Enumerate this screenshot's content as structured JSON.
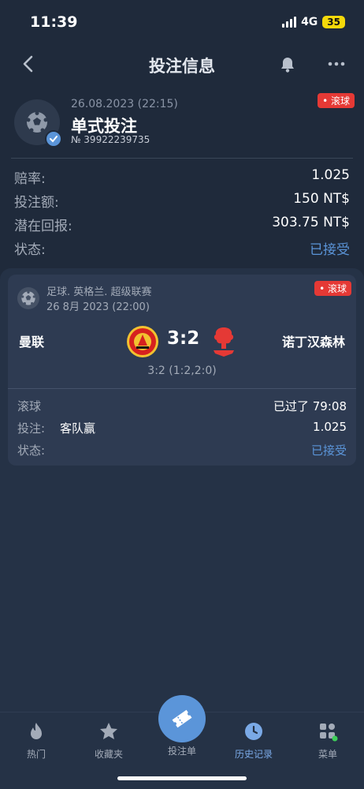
{
  "status_bar": {
    "time": "11:39",
    "network": "4G",
    "battery": "35"
  },
  "header": {
    "title": "投注信息",
    "icons": [
      "chevron-left-icon",
      "bell-icon",
      "more-icon"
    ]
  },
  "bet": {
    "date": "26.08.2023 (22:15)",
    "type": "单式投注",
    "id": "№ 39922239735",
    "live_badge": "• 滚球"
  },
  "summary": {
    "rows": [
      {
        "label": "赔率:",
        "value": "1.025"
      },
      {
        "label": "投注额:",
        "value": "150 NT$"
      },
      {
        "label": "潜在回报:",
        "value": "303.75 NT$"
      },
      {
        "label": "状态:",
        "value": "已接受"
      }
    ]
  },
  "match": {
    "league": "足球. 英格兰. 超级联赛",
    "date": "26 8月 2023 (22:00)",
    "live_badge": "• 滚球",
    "home_team": "曼联",
    "away_team": "诺丁汉森林",
    "score": "3:2",
    "halves": "3:2 (1:2,2:0)",
    "live_label": "滚球",
    "elapsed": "已过了 79:08",
    "bet_label": "投注:",
    "bet_pick": "客队赢",
    "bet_odds": "1.025",
    "status_label": "状态:",
    "status_value": "已接受"
  },
  "tabbar": {
    "tabs": [
      {
        "label": "热门",
        "icon": "fire-icon"
      },
      {
        "label": "收藏夹",
        "icon": "star-icon"
      },
      {
        "label": "投注单",
        "icon": "ticket-icon"
      },
      {
        "label": "历史记录",
        "icon": "clock-icon",
        "active": true
      },
      {
        "label": "菜单",
        "icon": "grid-icon"
      }
    ]
  },
  "colors": {
    "background": "#1f2a3b",
    "accent": "#5b95d9",
    "live_red": "#e53935",
    "battery": "#f5d90a"
  }
}
